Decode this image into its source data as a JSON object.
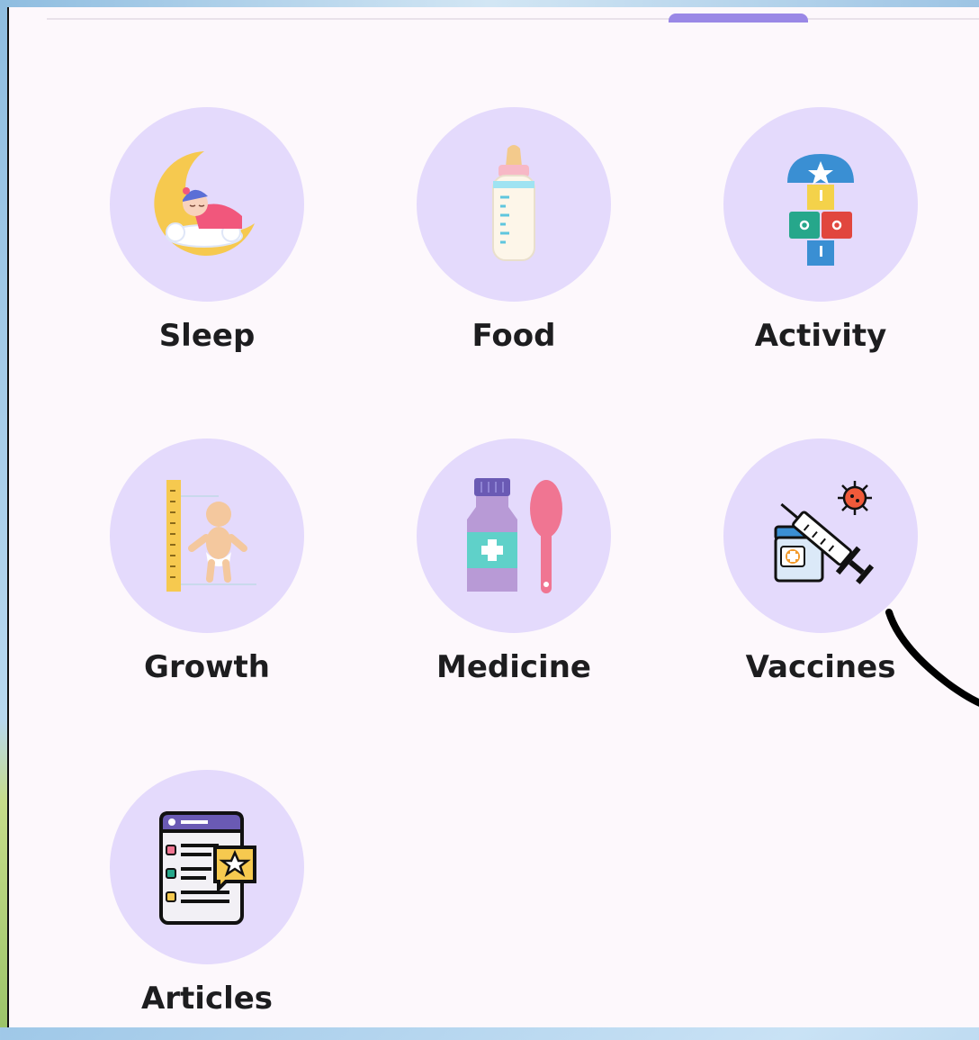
{
  "features": [
    {
      "label": "Sleep",
      "icon": "sleeping-baby-moon-icon"
    },
    {
      "label": "Food",
      "icon": "baby-bottle-icon"
    },
    {
      "label": "Activity",
      "icon": "hopscotch-icon"
    },
    {
      "label": "Growth",
      "icon": "baby-height-ruler-icon"
    },
    {
      "label": "Medicine",
      "icon": "medicine-bottle-spoon-icon"
    },
    {
      "label": "Vaccines",
      "icon": "syringe-vaccine-icon"
    },
    {
      "label": "Articles",
      "icon": "article-list-icon"
    }
  ],
  "colors": {
    "circle": "#e4dafc",
    "tab_indicator": "#9a88e6",
    "panel": "#fdf8fc",
    "text": "#1d1d1f"
  }
}
